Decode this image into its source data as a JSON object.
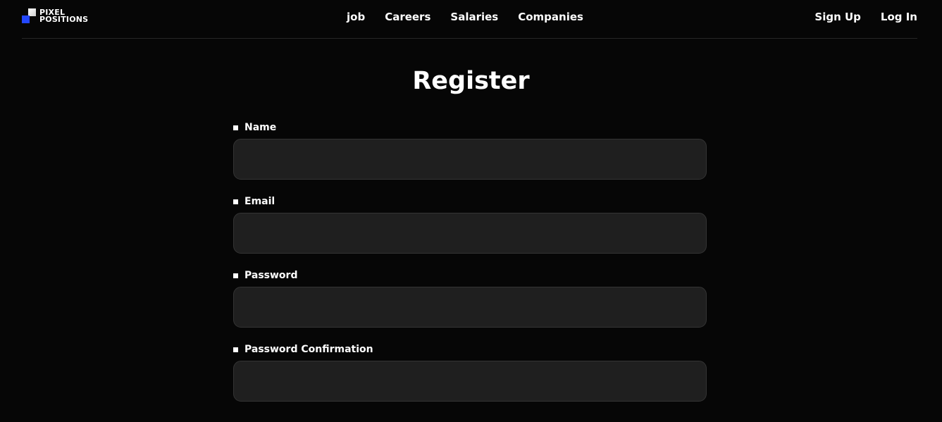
{
  "brand": {
    "logo_line1": "PIXEL",
    "logo_line2": "POSITIONS"
  },
  "nav": {
    "items": [
      {
        "label": "job"
      },
      {
        "label": "Careers"
      },
      {
        "label": "Salaries"
      },
      {
        "label": "Companies"
      }
    ]
  },
  "auth": {
    "sign_up": "Sign Up",
    "log_in": "Log In"
  },
  "page": {
    "title": "Register"
  },
  "form": {
    "fields": [
      {
        "label": "Name",
        "value": "",
        "placeholder": ""
      },
      {
        "label": "Email",
        "value": "",
        "placeholder": ""
      },
      {
        "label": "Password",
        "value": "",
        "placeholder": ""
      },
      {
        "label": "Password Confirmation",
        "value": "",
        "placeholder": ""
      }
    ]
  },
  "colors": {
    "background": "#060606",
    "input_background": "#1f1f1f",
    "logo_blue": "#2347ff",
    "text": "#ffffff"
  }
}
